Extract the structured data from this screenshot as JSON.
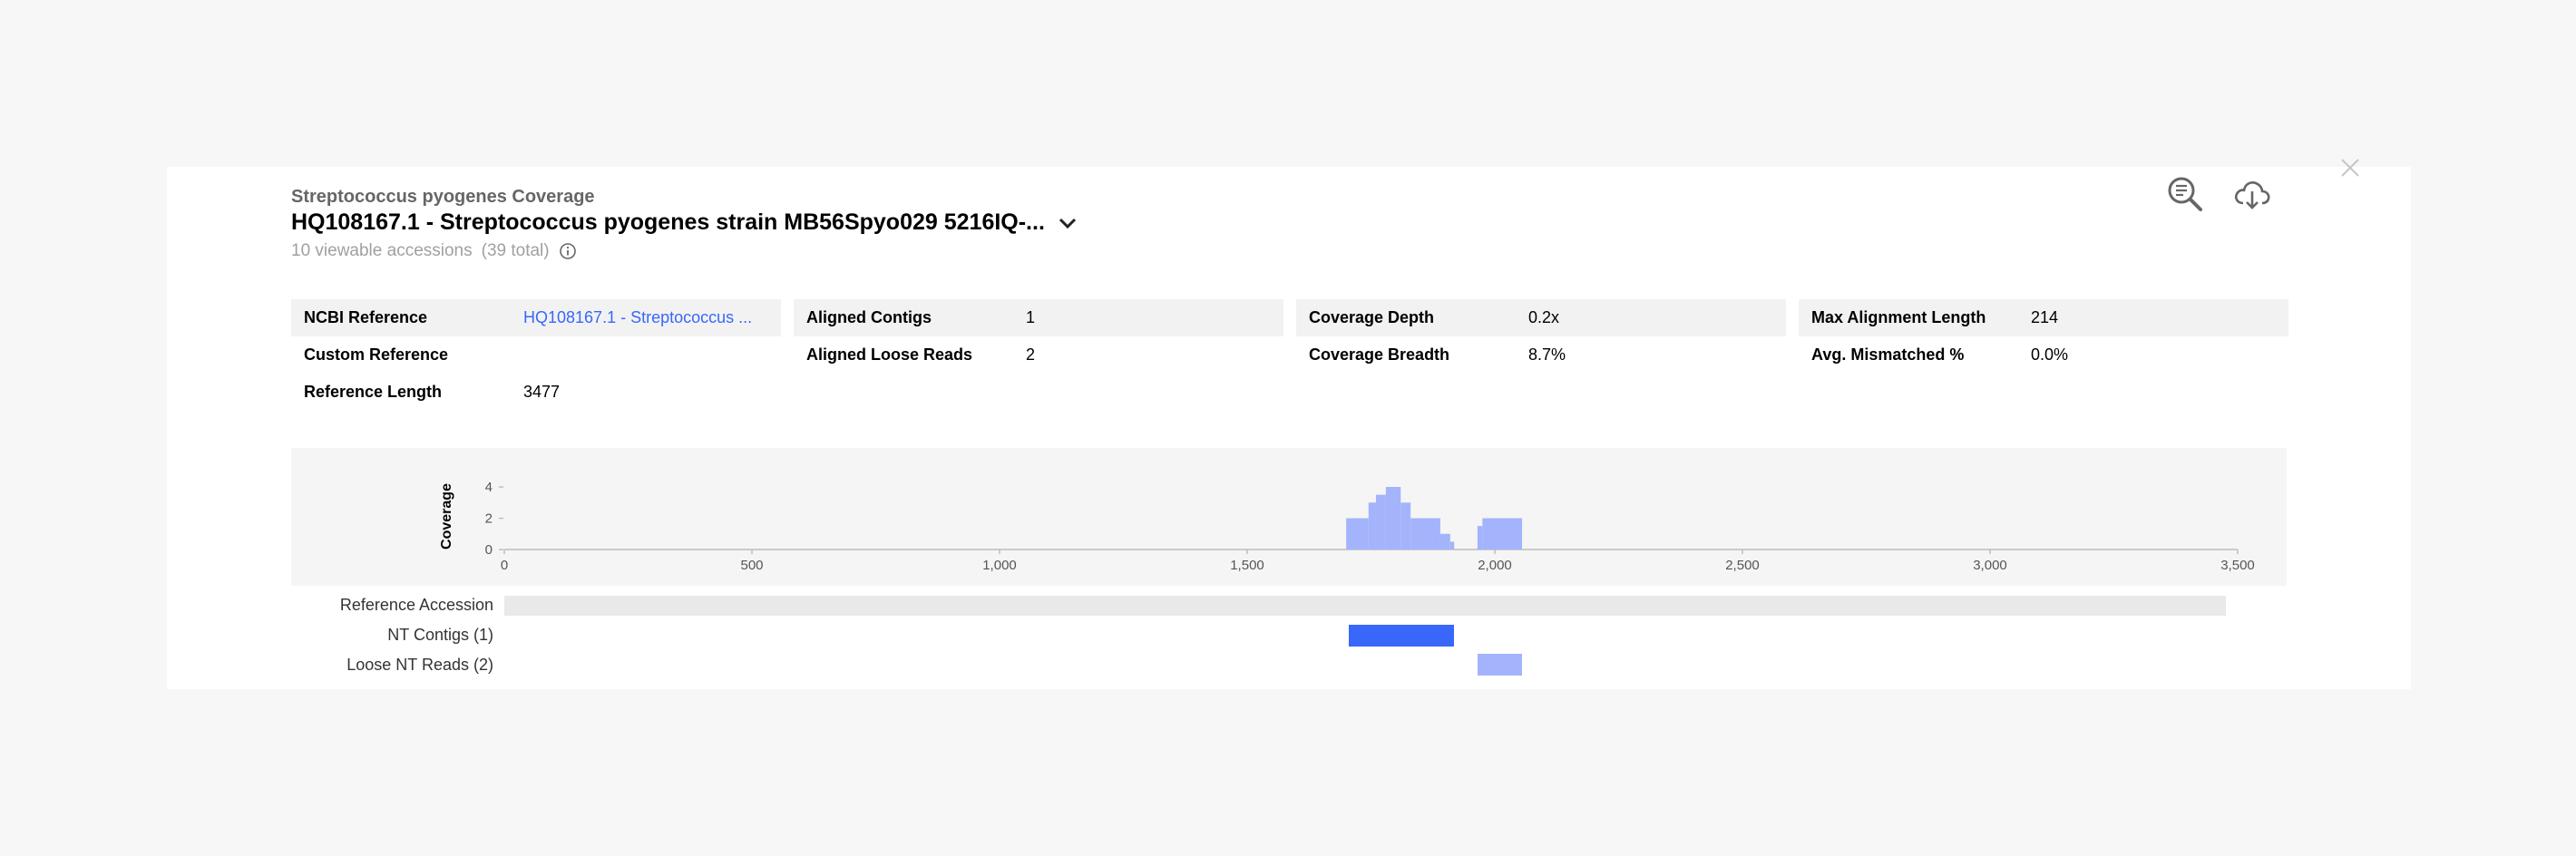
{
  "header": {
    "kicker": "Streptococcus pyogenes Coverage",
    "title": "HQ108167.1 - Streptococcus pyogenes strain MB56Spyo029 5216IQ-...",
    "accessions_note": "10 viewable accessions",
    "accessions_total": "(39 total)"
  },
  "icons": {
    "close": "close-icon",
    "search": "zoom-search-icon",
    "download": "cloud-download-icon",
    "info": "info-icon",
    "chevron": "chevron-down-icon"
  },
  "metrics": {
    "col1": [
      {
        "label": "NCBI Reference",
        "value": "HQ108167.1 - Streptococcus ..."
      },
      {
        "label": "Custom Reference",
        "value": ""
      },
      {
        "label": "Reference Length",
        "value": "3477"
      }
    ],
    "col2": [
      {
        "label": "Aligned Contigs",
        "value": "1"
      },
      {
        "label": "Aligned Loose Reads",
        "value": "2"
      }
    ],
    "col3": [
      {
        "label": "Coverage Depth",
        "value": "0.2x"
      },
      {
        "label": "Coverage Breadth",
        "value": "8.7%"
      }
    ],
    "col4": [
      {
        "label": "Max Alignment Length",
        "value": "214"
      },
      {
        "label": "Avg. Mismatched %",
        "value": "0.0%"
      }
    ]
  },
  "tracks": {
    "reference_label": "Reference Accession",
    "contigs_label": "NT Contigs (1)",
    "reads_label": "Loose NT Reads (2)",
    "reference_range": [
      0,
      3477
    ],
    "contigs": [
      {
        "start": 1705,
        "end": 1918
      }
    ],
    "reads": [
      {
        "start": 1965,
        "end": 2055
      }
    ]
  },
  "colors": {
    "coverage_bar": "#a3b4fc",
    "contig": "#3867fa",
    "read": "#a3b4fc",
    "reference": "#e9e9e9",
    "link": "#3867fa"
  },
  "chart_data": {
    "type": "bar",
    "title": "",
    "xlabel": "",
    "ylabel": "Coverage",
    "xlim": [
      0,
      3500
    ],
    "ylim": [
      0,
      4
    ],
    "x_ticks": [
      0,
      500,
      1000,
      1500,
      2000,
      2500,
      3000,
      3500
    ],
    "x_tick_labels": [
      "0",
      "500",
      "1,000",
      "1,500",
      "2,000",
      "2,500",
      "3,000",
      "3,500"
    ],
    "y_ticks": [
      0,
      2,
      4
    ],
    "y_tick_labels": [
      "0",
      "2",
      "4"
    ],
    "bars": [
      {
        "x0": 1700,
        "x1": 1745,
        "y": 2
      },
      {
        "x0": 1745,
        "x1": 1760,
        "y": 3
      },
      {
        "x0": 1760,
        "x1": 1780,
        "y": 3.5
      },
      {
        "x0": 1780,
        "x1": 1810,
        "y": 4
      },
      {
        "x0": 1810,
        "x1": 1830,
        "y": 3
      },
      {
        "x0": 1830,
        "x1": 1890,
        "y": 2
      },
      {
        "x0": 1890,
        "x1": 1910,
        "y": 1
      },
      {
        "x0": 1910,
        "x1": 1918,
        "y": 0.5
      },
      {
        "x0": 1965,
        "x1": 1975,
        "y": 1.5
      },
      {
        "x0": 1975,
        "x1": 2055,
        "y": 2
      }
    ]
  }
}
